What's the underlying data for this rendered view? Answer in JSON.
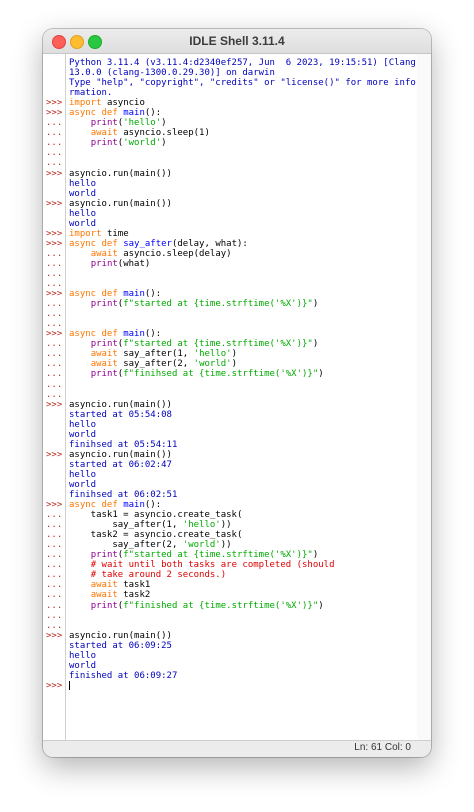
{
  "window": {
    "title": "IDLE Shell 3.11.4"
  },
  "colors": {
    "prompt": "#b52a1d",
    "output": "#0000bb",
    "keyword": "#ff7700",
    "builtin": "#900090",
    "string": "#00aa00",
    "def_name": "#0000ff",
    "comment": "#dd0000"
  },
  "status": {
    "line_col": "Ln: 61  Col: 0"
  },
  "lines": [
    {
      "p": "",
      "c": "out",
      "t": "Python 3.11.4 (v3.11.4:d2340ef257, Jun  6 2023, 19:15:51) [Clang"
    },
    {
      "p": "",
      "c": "out",
      "t": "13.0.0 (clang-1300.0.29.30)] on darwin"
    },
    {
      "p": "",
      "c": "out",
      "t": "Type \"help\", \"copyright\", \"credits\" or \"license()\" for more info"
    },
    {
      "p": "",
      "c": "out",
      "t": "rmation."
    },
    {
      "p": ">>>",
      "c": "code",
      "s": [
        [
          "kw",
          "import"
        ],
        [
          "",
          "asyncio"
        ]
      ]
    },
    {
      "p": ">>>",
      "c": "code",
      "s": [
        [
          "kw",
          "async def"
        ],
        [
          "fn",
          "main"
        ],
        [
          "",
          "():"
        ]
      ]
    },
    {
      "p": "...",
      "c": "code",
      "s": [
        [
          "",
          "    "
        ],
        [
          "bi",
          "print"
        ],
        [
          "",
          "("
        ],
        [
          "st",
          "'hello'"
        ],
        [
          "",
          ")"
        ]
      ]
    },
    {
      "p": "...",
      "c": "code",
      "s": [
        [
          "",
          "    "
        ],
        [
          "kw",
          "await"
        ],
        [
          "",
          "asyncio.sleep(1)"
        ]
      ]
    },
    {
      "p": "...",
      "c": "code",
      "s": [
        [
          "",
          "    "
        ],
        [
          "bi",
          "print"
        ],
        [
          "",
          "("
        ],
        [
          "st",
          "'world'"
        ],
        [
          "",
          ")"
        ]
      ]
    },
    {
      "p": "...",
      "c": "code",
      "s": []
    },
    {
      "p": "...",
      "c": "code",
      "s": []
    },
    {
      "p": ">>>",
      "c": "code",
      "s": [
        [
          "",
          "asyncio.run(main())"
        ]
      ]
    },
    {
      "p": "",
      "c": "stdout",
      "t": "hello"
    },
    {
      "p": "",
      "c": "stdout",
      "t": "world"
    },
    {
      "p": ">>>",
      "c": "code",
      "s": [
        [
          "",
          "asyncio.run(main())"
        ]
      ]
    },
    {
      "p": "",
      "c": "stdout",
      "t": "hello"
    },
    {
      "p": "",
      "c": "stdout",
      "t": "world"
    },
    {
      "p": ">>>",
      "c": "code",
      "s": [
        [
          "kw",
          "import"
        ],
        [
          "",
          "time"
        ]
      ]
    },
    {
      "p": ">>>",
      "c": "code",
      "s": [
        [
          "kw",
          "async def"
        ],
        [
          "fn",
          "say_after"
        ],
        [
          "",
          "(delay, what):"
        ]
      ]
    },
    {
      "p": "...",
      "c": "code",
      "s": [
        [
          "",
          "    "
        ],
        [
          "kw",
          "await"
        ],
        [
          "",
          "asyncio.sleep(delay)"
        ]
      ]
    },
    {
      "p": "...",
      "c": "code",
      "s": [
        [
          "",
          "    "
        ],
        [
          "bi",
          "print"
        ],
        [
          "",
          "(what)"
        ]
      ]
    },
    {
      "p": "...",
      "c": "code",
      "s": []
    },
    {
      "p": "...",
      "c": "code",
      "s": []
    },
    {
      "p": ">>>",
      "c": "code",
      "s": [
        [
          "kw",
          "async def"
        ],
        [
          "fn",
          "main"
        ],
        [
          "",
          "():"
        ]
      ]
    },
    {
      "p": "...",
      "c": "code",
      "s": [
        [
          "",
          "    "
        ],
        [
          "bi",
          "print"
        ],
        [
          "",
          "("
        ],
        [
          "st",
          "f\"started at {time.strftime('%X')}\""
        ],
        [
          "",
          ")"
        ]
      ]
    },
    {
      "p": "...",
      "c": "code",
      "s": []
    },
    {
      "p": "...",
      "c": "code",
      "s": []
    },
    {
      "p": ">>>",
      "c": "code",
      "s": [
        [
          "kw",
          "async def"
        ],
        [
          "fn",
          "main"
        ],
        [
          "",
          "():"
        ]
      ]
    },
    {
      "p": "...",
      "c": "code",
      "s": [
        [
          "",
          "    "
        ],
        [
          "bi",
          "print"
        ],
        [
          "",
          "("
        ],
        [
          "st",
          "f\"started at {time.strftime('%X')}\""
        ],
        [
          "",
          ")"
        ]
      ]
    },
    {
      "p": "...",
      "c": "code",
      "s": [
        [
          "",
          "    "
        ],
        [
          "kw",
          "await"
        ],
        [
          "",
          "say_after(1, "
        ],
        [
          "st",
          "'hello'"
        ],
        [
          "",
          ")"
        ]
      ]
    },
    {
      "p": "...",
      "c": "code",
      "s": [
        [
          "",
          "    "
        ],
        [
          "kw",
          "await"
        ],
        [
          "",
          "say_after(2, "
        ],
        [
          "st",
          "'world'"
        ],
        [
          "",
          ")"
        ]
      ]
    },
    {
      "p": "...",
      "c": "code",
      "s": [
        [
          "",
          "    "
        ],
        [
          "bi",
          "print"
        ],
        [
          "",
          "("
        ],
        [
          "st",
          "f\"finihsed at {time.strftime('%X')}\""
        ],
        [
          "",
          ")"
        ]
      ]
    },
    {
      "p": "...",
      "c": "code",
      "s": []
    },
    {
      "p": "...",
      "c": "code",
      "s": []
    },
    {
      "p": ">>>",
      "c": "code",
      "s": [
        [
          "",
          "asyncio.run(main())"
        ]
      ]
    },
    {
      "p": "",
      "c": "stdout",
      "t": "started at 05:54:08"
    },
    {
      "p": "",
      "c": "stdout",
      "t": "hello"
    },
    {
      "p": "",
      "c": "stdout",
      "t": "world"
    },
    {
      "p": "",
      "c": "stdout",
      "t": "finihsed at 05:54:11"
    },
    {
      "p": ">>>",
      "c": "code",
      "s": [
        [
          "",
          "asyncio.run(main())"
        ]
      ]
    },
    {
      "p": "",
      "c": "stdout",
      "t": "started at 06:02:47"
    },
    {
      "p": "",
      "c": "stdout",
      "t": "hello"
    },
    {
      "p": "",
      "c": "stdout",
      "t": "world"
    },
    {
      "p": "",
      "c": "stdout",
      "t": "finihsed at 06:02:51"
    },
    {
      "p": ">>>",
      "c": "code",
      "s": [
        [
          "kw",
          "async def"
        ],
        [
          "fn",
          "main"
        ],
        [
          "",
          "():"
        ]
      ]
    },
    {
      "p": "...",
      "c": "code",
      "s": [
        [
          "",
          "    task1 = asyncio.create_task("
        ]
      ]
    },
    {
      "p": "...",
      "c": "code",
      "s": [
        [
          "",
          "        say_after(1, "
        ],
        [
          "st",
          "'hello'"
        ],
        [
          "",
          "))"
        ]
      ]
    },
    {
      "p": "...",
      "c": "code",
      "s": [
        [
          "",
          "    task2 = asyncio.create_task("
        ]
      ]
    },
    {
      "p": "...",
      "c": "code",
      "s": [
        [
          "",
          "        say_after(2, "
        ],
        [
          "st",
          "'world'"
        ],
        [
          "",
          "))"
        ]
      ]
    },
    {
      "p": "...",
      "c": "code",
      "s": [
        [
          "",
          "    "
        ],
        [
          "bi",
          "print"
        ],
        [
          "",
          "("
        ],
        [
          "st",
          "f\"started at {time.strftime('%X')}\""
        ],
        [
          "",
          ")"
        ]
      ]
    },
    {
      "p": "...",
      "c": "code",
      "s": [
        [
          "",
          "    "
        ],
        [
          "cm",
          "# wait until both tasks are completed (should"
        ]
      ]
    },
    {
      "p": "...",
      "c": "code",
      "s": [
        [
          "",
          "    "
        ],
        [
          "cm",
          "# take around 2 seconds.)"
        ]
      ]
    },
    {
      "p": "...",
      "c": "code",
      "s": [
        [
          "",
          "    "
        ],
        [
          "kw",
          "await"
        ],
        [
          "",
          "task1"
        ]
      ]
    },
    {
      "p": "...",
      "c": "code",
      "s": [
        [
          "",
          "    "
        ],
        [
          "kw",
          "await"
        ],
        [
          "",
          "task2"
        ]
      ]
    },
    {
      "p": "...",
      "c": "code",
      "s": [
        [
          "",
          "    "
        ],
        [
          "bi",
          "print"
        ],
        [
          "",
          "("
        ],
        [
          "st",
          "f\"finished at {time.strftime('%X')}\""
        ],
        [
          "",
          ")"
        ]
      ]
    },
    {
      "p": "...",
      "c": "code",
      "s": []
    },
    {
      "p": "...",
      "c": "code",
      "s": []
    },
    {
      "p": ">>>",
      "c": "code",
      "s": [
        [
          "",
          "asyncio.run(main())"
        ]
      ]
    },
    {
      "p": "",
      "c": "stdout",
      "t": "started at 06:09:25"
    },
    {
      "p": "",
      "c": "stdout",
      "t": "hello"
    },
    {
      "p": "",
      "c": "stdout",
      "t": "world"
    },
    {
      "p": "",
      "c": "stdout",
      "t": "finished at 06:09:27"
    },
    {
      "p": ">>>",
      "c": "cursor",
      "s": []
    }
  ]
}
